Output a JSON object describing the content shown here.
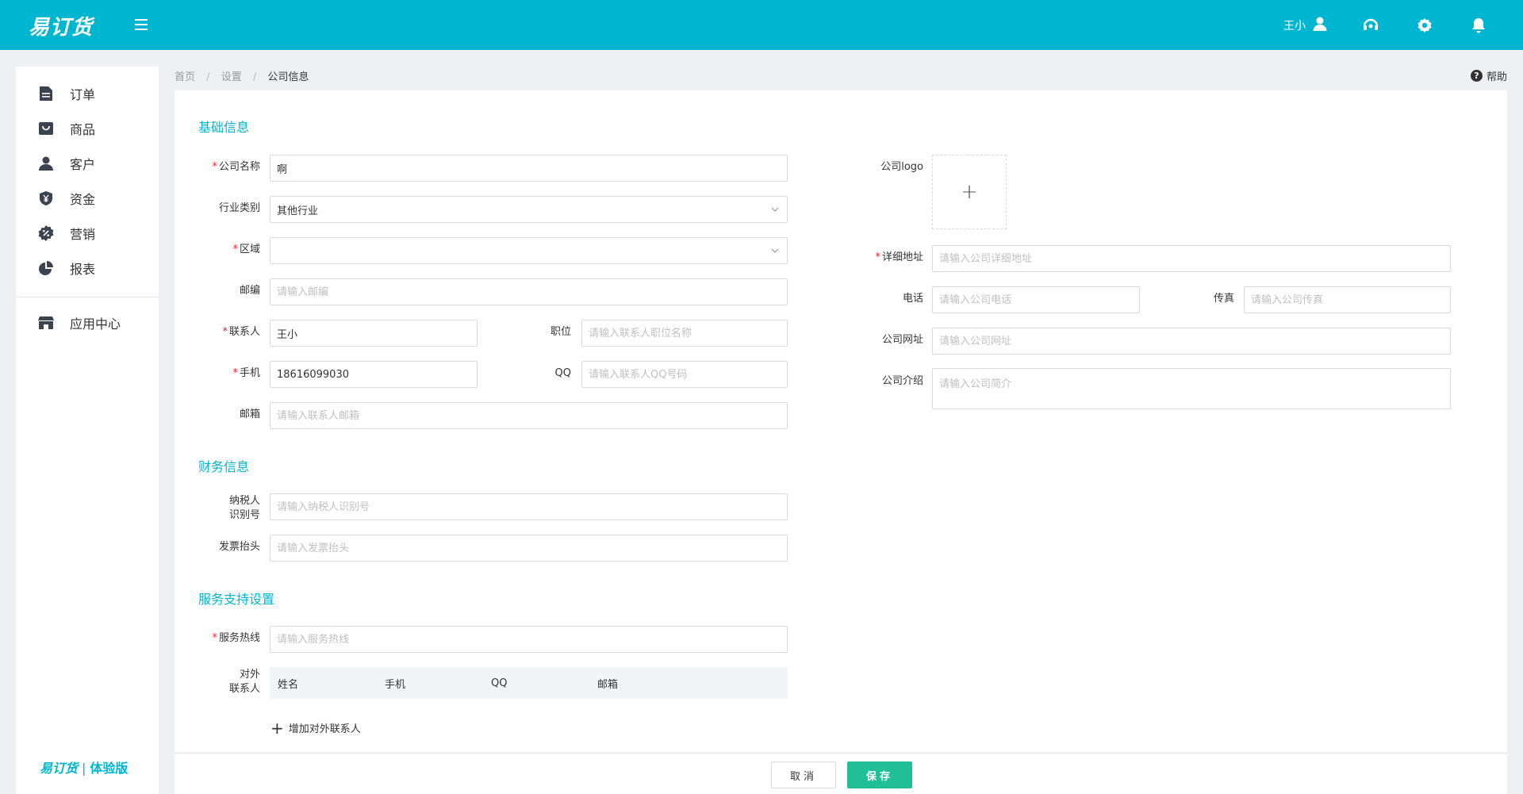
{
  "app": {
    "logo": "易订货",
    "user_name": "王小"
  },
  "sidebar": {
    "items": [
      {
        "label": "订单",
        "icon": "document-icon"
      },
      {
        "label": "商品",
        "icon": "bag-icon"
      },
      {
        "label": "客户",
        "icon": "user-icon"
      },
      {
        "label": "资金",
        "icon": "shield-yen-icon"
      },
      {
        "label": "营销",
        "icon": "discount-badge-icon"
      },
      {
        "label": "报表",
        "icon": "pie-chart-icon"
      }
    ],
    "app_center": "应用中心",
    "brand_logo": "易订货",
    "brand_sep": "|",
    "brand_edition": "体验版"
  },
  "breadcrumb": {
    "home": "首页",
    "settings": "设置",
    "current": "公司信息",
    "sep": "/"
  },
  "help": {
    "label": "帮助",
    "icon_glyph": "?"
  },
  "sections": {
    "basic": "基础信息",
    "finance": "财务信息",
    "service": "服务支持设置"
  },
  "basic": {
    "company_name": {
      "label": "公司名称",
      "value": "啊"
    },
    "industry": {
      "label": "行业类别",
      "value": "其他行业"
    },
    "region": {
      "label": "区域",
      "value": ""
    },
    "postcode": {
      "label": "邮编",
      "placeholder": "请输入邮编"
    },
    "contact": {
      "label": "联系人",
      "value": "王小"
    },
    "position": {
      "label": "职位",
      "placeholder": "请输入联系人职位名称"
    },
    "mobile": {
      "label": "手机",
      "value": "18616099030"
    },
    "qq": {
      "label": "QQ",
      "placeholder": "请输入联系人QQ号码"
    },
    "email": {
      "label": "邮箱",
      "placeholder": "请输入联系人邮箱"
    },
    "logo": {
      "label": "公司logo",
      "plus": "+"
    },
    "address": {
      "label": "详细地址",
      "placeholder": "请输入公司详细地址"
    },
    "phone": {
      "label": "电话",
      "placeholder": "请输入公司电话"
    },
    "fax": {
      "label": "传真",
      "placeholder": "请输入公司传真"
    },
    "website": {
      "label": "公司网址",
      "placeholder": "请输入公司网址"
    },
    "intro": {
      "label": "公司介绍",
      "placeholder": "请输入公司简介"
    }
  },
  "finance": {
    "taxpayer": {
      "label_line1": "纳税人",
      "label_line2": "识别号",
      "placeholder": "请输入纳税人识别号"
    },
    "invoice": {
      "label": "发票抬头",
      "placeholder": "请输入发票抬头"
    }
  },
  "service": {
    "hotline": {
      "label": "服务热线",
      "placeholder": "请输入服务热线"
    },
    "external_contacts": {
      "label_line1": "对外",
      "label_line2": "联系人",
      "columns": [
        "姓名",
        "手机",
        "QQ",
        "邮箱"
      ]
    },
    "add_contact": "增加对外联系人",
    "add_glyph": "+"
  },
  "footer": {
    "cancel": "取消",
    "save": "保存"
  },
  "colors": {
    "primary": "#00b5cf",
    "save": "#1fc097",
    "required": "#f5222d"
  }
}
